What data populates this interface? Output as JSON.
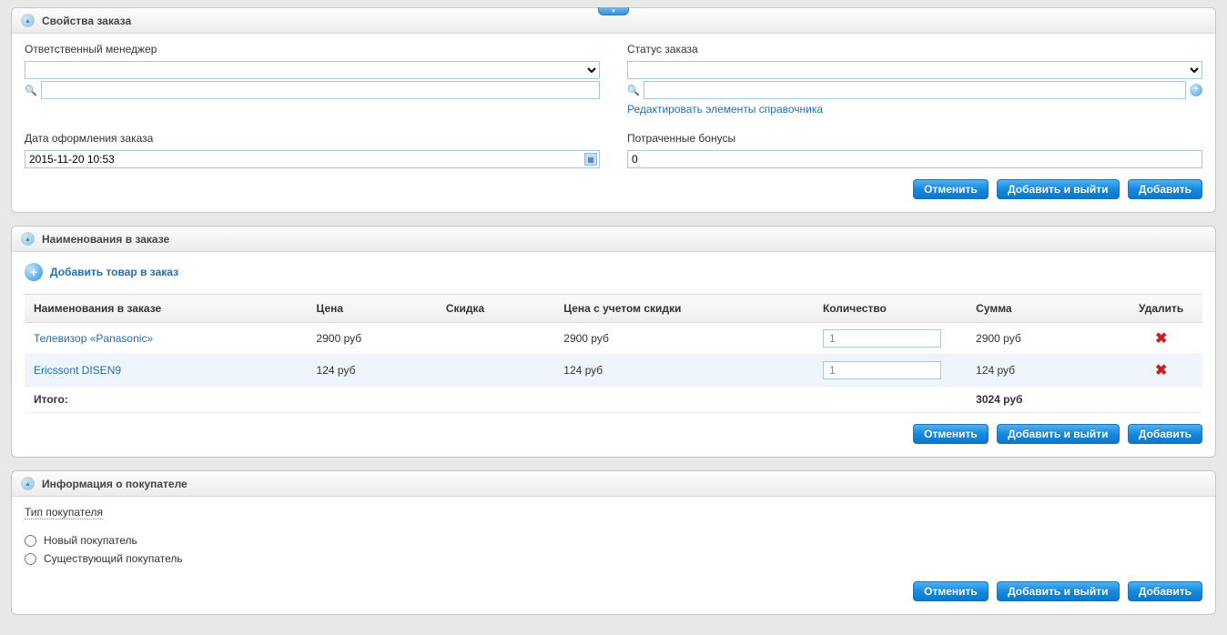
{
  "panels": {
    "properties": {
      "title": "Свойства заказа",
      "manager_label": "Ответственный менеджер",
      "status_label": "Статус заказа",
      "edit_ref_link": "Редактировать элементы справочника",
      "order_date_label": "Дата оформления заказа",
      "order_date_value": "2015-11-20 10:53",
      "bonus_label": "Потраченные бонусы",
      "bonus_value": "0"
    },
    "items": {
      "title": "Наименования в заказе",
      "add_link": "Добавить товар в заказ",
      "columns": {
        "name": "Наименования в заказе",
        "price": "Цена",
        "discount": "Скидка",
        "disc_price": "Цена с учетом скидки",
        "qty": "Количество",
        "sum": "Сумма",
        "delete": "Удалить"
      },
      "rows": [
        {
          "name": "Телевизор «Panasonic»",
          "price": "2900 руб",
          "disc_price": "2900 руб",
          "qty": "1",
          "sum": "2900 руб"
        },
        {
          "name": "Ericssont DISEN9",
          "price": "124 руб",
          "disc_price": "124 руб",
          "qty": "1",
          "sum": "124 руб"
        }
      ],
      "total_label": "Итого:",
      "total_value": "3024 руб"
    },
    "buyer": {
      "title": "Информация о покупателе",
      "type_label": "Тип покупателя",
      "opt_new": "Новый покупатель",
      "opt_existing": "Существующий покупатель"
    }
  },
  "buttons": {
    "cancel": "Отменить",
    "save_exit": "Добавить и выйти",
    "save": "Добавить"
  }
}
